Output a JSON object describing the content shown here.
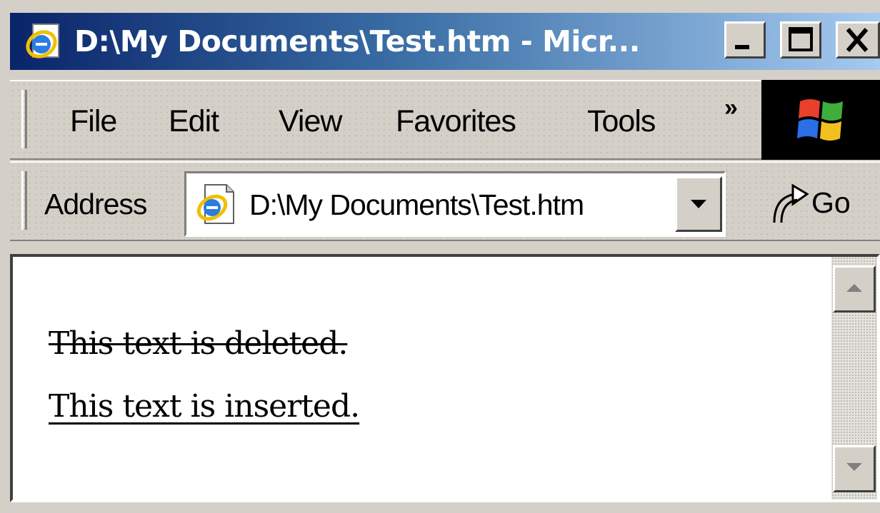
{
  "window": {
    "title": "D:\\My Documents\\Test.htm - Micr...",
    "icon": "ie-icon"
  },
  "menu": {
    "items": [
      "File",
      "Edit",
      "View",
      "Favorites",
      "Tools"
    ],
    "overflow": "»"
  },
  "address_bar": {
    "label": "Address",
    "value": "D:\\My Documents\\Test.htm",
    "go_label": "Go"
  },
  "content": {
    "deleted_text": "This text is deleted.",
    "inserted_text": "This text is inserted."
  },
  "colors": {
    "title_start": "#0a246a",
    "title_end": "#a6caf0",
    "chrome": "#d4d0c8"
  }
}
